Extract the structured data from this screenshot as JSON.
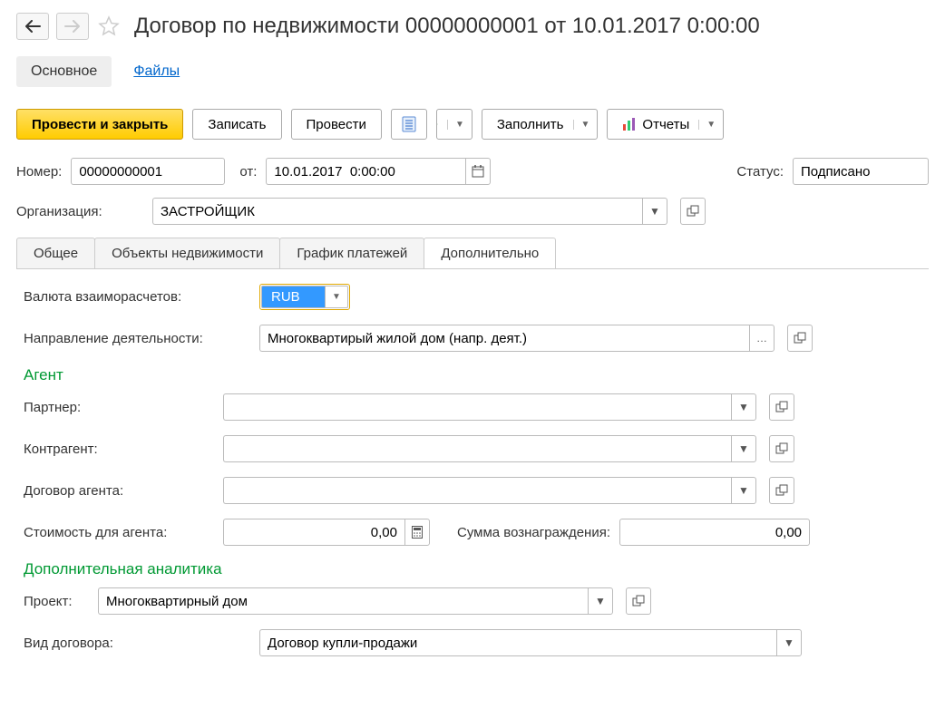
{
  "header": {
    "title": "Договор по недвижимости 00000000001 от 10.01.2017 0:00:00"
  },
  "sub_tabs": {
    "main": "Основное",
    "files": "Файлы"
  },
  "toolbar": {
    "post_close": "Провести и закрыть",
    "save": "Записать",
    "post": "Провести",
    "fill": "Заполнить",
    "reports": "Отчеты"
  },
  "fields": {
    "number_label": "Номер:",
    "number_value": "00000000001",
    "date_label": "от:",
    "date_value": "10.01.2017  0:00:00",
    "status_label": "Статус:",
    "status_value": "Подписано",
    "org_label": "Организация:",
    "org_value": "ЗАСТРОЙЩИК"
  },
  "main_tabs": {
    "general": "Общее",
    "objects": "Объекты недвижимости",
    "schedule": "График платежей",
    "additional": "Дополнительно"
  },
  "additional": {
    "currency_label": "Валюта взаиморасчетов:",
    "currency_value": "RUB",
    "direction_label": "Направление деятельности:",
    "direction_value": "Многоквартирый жилой дом (напр. деят.)",
    "agent_section": "Агент",
    "partner_label": "Партнер:",
    "partner_value": "",
    "counterparty_label": "Контрагент:",
    "counterparty_value": "",
    "agent_contract_label": "Договор агента:",
    "agent_contract_value": "",
    "agent_cost_label": "Стоимость для агента:",
    "agent_cost_value": "0,00",
    "reward_label": "Сумма вознаграждения:",
    "reward_value": "0,00",
    "analytics_section": "Дополнительная аналитика",
    "project_label": "Проект:",
    "project_value": "Многоквартирный дом",
    "contract_type_label": "Вид договора:",
    "contract_type_value": "Договор купли-продажи"
  }
}
